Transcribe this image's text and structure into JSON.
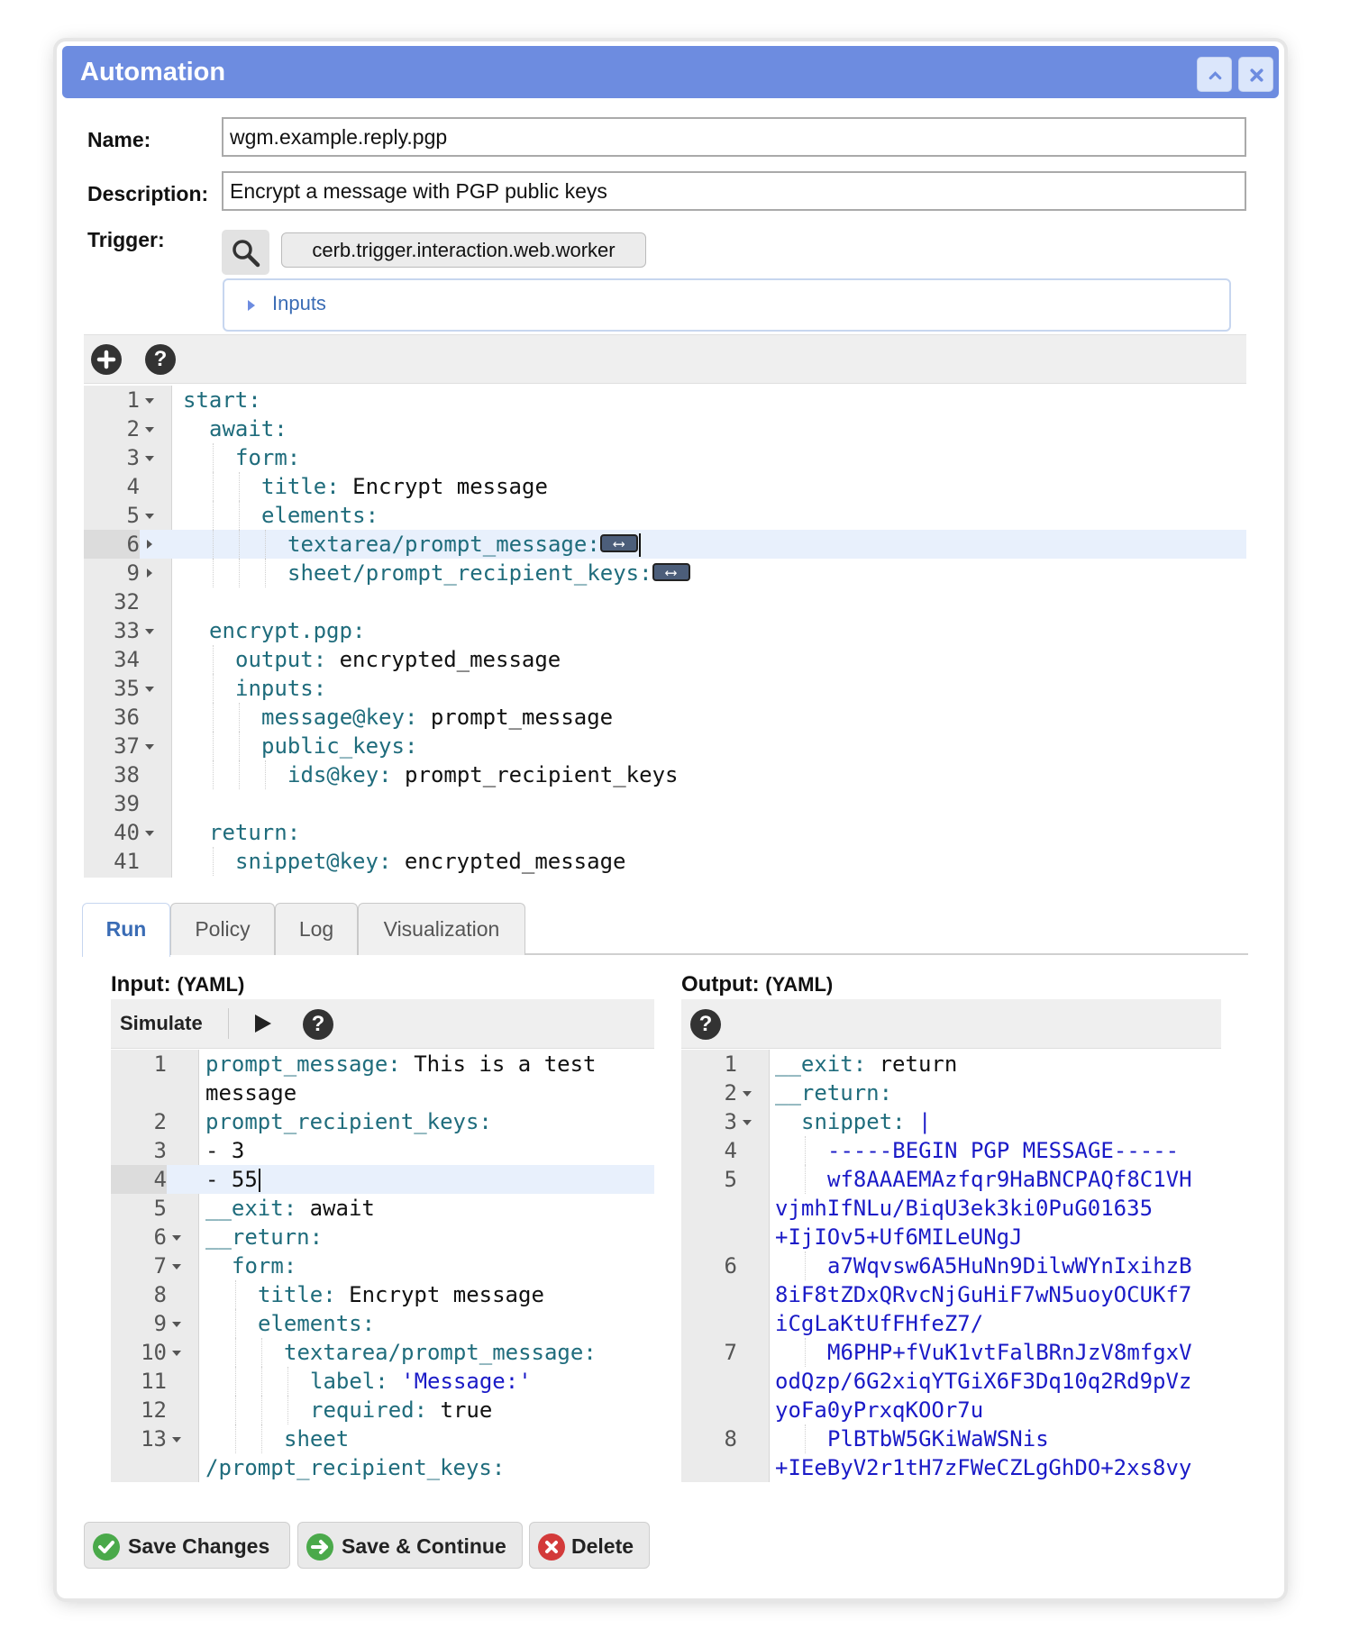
{
  "dialog": {
    "title": "Automation"
  },
  "form": {
    "name_label": "Name:",
    "name_value": "wgm.example.reply.pgp",
    "description_label": "Description:",
    "description_value": "Encrypt a message with PGP public keys",
    "trigger_label": "Trigger:",
    "trigger_value": "cerb.trigger.interaction.web.worker",
    "inputs_legend": "Inputs"
  },
  "script_editor": {
    "toolbar_icons": [
      "add-icon",
      "help-icon"
    ],
    "lines": [
      {
        "n": "1",
        "fold": "open",
        "indent": 0,
        "key": "start:",
        "val": ""
      },
      {
        "n": "2",
        "fold": "open",
        "indent": 1,
        "key": "await:",
        "val": ""
      },
      {
        "n": "3",
        "fold": "open",
        "indent": 2,
        "key": "form:",
        "val": ""
      },
      {
        "n": "4",
        "fold": "",
        "indent": 3,
        "key": "title:",
        "val": " Encrypt message"
      },
      {
        "n": "5",
        "fold": "open",
        "indent": 3,
        "key": "elements:",
        "val": ""
      },
      {
        "n": "6",
        "fold": "closed",
        "indent": 4,
        "key": "textarea/prompt_message:",
        "val": "",
        "widget": true,
        "highlight": true,
        "cursor": true
      },
      {
        "n": "9",
        "fold": "closed",
        "indent": 4,
        "key": "sheet/prompt_recipient_keys:",
        "val": "",
        "widget": true
      },
      {
        "n": "32",
        "fold": "",
        "indent": 0,
        "key": "",
        "val": ""
      },
      {
        "n": "33",
        "fold": "open",
        "indent": 1,
        "key": "encrypt.pgp:",
        "val": ""
      },
      {
        "n": "34",
        "fold": "",
        "indent": 2,
        "key": "output:",
        "val": " encrypted_message"
      },
      {
        "n": "35",
        "fold": "open",
        "indent": 2,
        "key": "inputs:",
        "val": ""
      },
      {
        "n": "36",
        "fold": "",
        "indent": 3,
        "key": "message@key:",
        "val": " prompt_message"
      },
      {
        "n": "37",
        "fold": "open",
        "indent": 3,
        "key": "public_keys:",
        "val": ""
      },
      {
        "n": "38",
        "fold": "",
        "indent": 4,
        "key": "ids@key:",
        "val": " prompt_recipient_keys"
      },
      {
        "n": "39",
        "fold": "",
        "indent": 0,
        "key": "",
        "val": ""
      },
      {
        "n": "40",
        "fold": "open",
        "indent": 1,
        "key": "return:",
        "val": ""
      },
      {
        "n": "41",
        "fold": "",
        "indent": 2,
        "key": "snippet@key:",
        "val": " encrypted_message"
      }
    ]
  },
  "tabs": [
    {
      "label": "Run",
      "active": true
    },
    {
      "label": "Policy",
      "active": false
    },
    {
      "label": "Log",
      "active": false
    },
    {
      "label": "Visualization",
      "active": false
    }
  ],
  "run": {
    "input_title": "Input:",
    "input_title_sub": "(YAML)",
    "output_title": "Output:",
    "output_title_sub": "(YAML)",
    "simulate_label": "Simulate",
    "input_lines": [
      {
        "n": "1",
        "fold": "",
        "indent": 0,
        "key": "prompt_message:",
        "val": " This is a test"
      },
      {
        "n": "",
        "fold": "",
        "indent": 0,
        "key": "",
        "val": "message"
      },
      {
        "n": "2",
        "fold": "",
        "indent": 0,
        "key": "prompt_recipient_keys:",
        "val": ""
      },
      {
        "n": "3",
        "fold": "",
        "indent": 0,
        "key": "",
        "val": "- 3"
      },
      {
        "n": "4",
        "fold": "",
        "indent": 0,
        "key": "",
        "val": "- 55",
        "highlight": true,
        "cursor": true
      },
      {
        "n": "5",
        "fold": "",
        "indent": 0,
        "key": "__exit:",
        "val": " await"
      },
      {
        "n": "6",
        "fold": "open",
        "indent": 0,
        "key": "__return:",
        "val": ""
      },
      {
        "n": "7",
        "fold": "open",
        "indent": 1,
        "key": "form:",
        "val": ""
      },
      {
        "n": "8",
        "fold": "",
        "indent": 2,
        "key": "title:",
        "val": " Encrypt message"
      },
      {
        "n": "9",
        "fold": "open",
        "indent": 2,
        "key": "elements:",
        "val": ""
      },
      {
        "n": "10",
        "fold": "open",
        "indent": 3,
        "key": "textarea/prompt_message:",
        "val": ""
      },
      {
        "n": "11",
        "fold": "",
        "indent": 4,
        "key": "label:",
        "val": "",
        "str": " 'Message:'"
      },
      {
        "n": "12",
        "fold": "",
        "indent": 4,
        "key": "required:",
        "val": " true"
      },
      {
        "n": "13",
        "fold": "open",
        "indent": 3,
        "key": "sheet",
        "val": ""
      },
      {
        "n": "",
        "fold": "",
        "indent": 0,
        "key": "/prompt_recipient_keys:",
        "val": ""
      }
    ],
    "output_lines": [
      {
        "n": "1",
        "fold": "",
        "indent": 0,
        "key": "__exit:",
        "val": " return"
      },
      {
        "n": "2",
        "fold": "open",
        "indent": 0,
        "key": "__return:",
        "val": ""
      },
      {
        "n": "3",
        "fold": "open",
        "indent": 1,
        "key": "snippet:",
        "val": "",
        "str": " |"
      },
      {
        "n": "4",
        "fold": "",
        "indent": 2,
        "key": "",
        "val": "",
        "str": "-----BEGIN PGP MESSAGE-----"
      },
      {
        "n": "5",
        "fold": "",
        "indent": 2,
        "key": "",
        "val": "",
        "str": "wf8AAAEMAzfqr9HaBNCPAQf8C1VH"
      },
      {
        "n": "",
        "fold": "",
        "indent": 0,
        "key": "",
        "val": "",
        "str": "vjmhIfNLu/BiqU3ek3ki0PuG01635"
      },
      {
        "n": "",
        "fold": "",
        "indent": 0,
        "key": "",
        "val": "",
        "str": "+IjIOv5+Uf6MILeUNgJ"
      },
      {
        "n": "6",
        "fold": "",
        "indent": 2,
        "key": "",
        "val": "",
        "str": "a7Wqvsw6A5HuNn9DilwWYnIxihzB"
      },
      {
        "n": "",
        "fold": "",
        "indent": 0,
        "key": "",
        "val": "",
        "str": "8iF8tZDxQRvcNjGuHiF7wN5uoyOCUKf7"
      },
      {
        "n": "",
        "fold": "",
        "indent": 0,
        "key": "",
        "val": "",
        "str": "iCgLaKtUfFHfeZ7/"
      },
      {
        "n": "7",
        "fold": "",
        "indent": 2,
        "key": "",
        "val": "",
        "str": "M6PHP+fVuK1vtFalBRnJzV8mfgxV"
      },
      {
        "n": "",
        "fold": "",
        "indent": 0,
        "key": "",
        "val": "",
        "str": "odQzp/6G2xiqYTGiX6F3Dq10q2Rd9pVz"
      },
      {
        "n": "",
        "fold": "",
        "indent": 0,
        "key": "",
        "val": "",
        "str": "yoFa0yPrxqKOOr7u"
      },
      {
        "n": "8",
        "fold": "",
        "indent": 2,
        "key": "",
        "val": "",
        "str": "PlBTbW5GKiWaWSNis"
      },
      {
        "n": "",
        "fold": "",
        "indent": 0,
        "key": "",
        "val": "",
        "str": "+IEeByV2r1tH7zFWeCZLgGhDO+2xs8vy"
      }
    ]
  },
  "actions": {
    "save_changes": "Save Changes",
    "save_continue": "Save & Continue",
    "delete": "Delete"
  },
  "colors": {
    "titlebar": "#6d8ce0",
    "yaml_key": "#1f6c7c",
    "yaml_string": "#1a1ac7",
    "save_icon": "#4aa94a",
    "delete_icon": "#d33a3a"
  }
}
